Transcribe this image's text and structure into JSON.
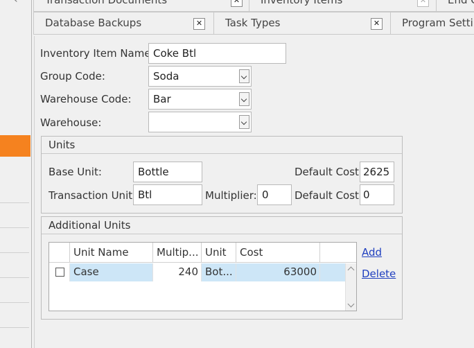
{
  "tabs_top": [
    {
      "label": "Transaction Documents"
    },
    {
      "label": "Inventory Items"
    },
    {
      "label": "End O"
    }
  ],
  "tabs": [
    {
      "label": "Database Backups"
    },
    {
      "label": "Task Types"
    },
    {
      "label": "Program Settin"
    }
  ],
  "form": {
    "item_name_label": "Inventory Item Name:",
    "item_name_value": "Coke Btl",
    "group_code_label": "Group Code:",
    "group_code_value": "Soda",
    "warehouse_code_label": "Warehouse Code:",
    "warehouse_code_value": "Bar",
    "warehouse_label": "Warehouse:",
    "warehouse_value": ""
  },
  "units": {
    "title": "Units",
    "base_unit_label": "Base Unit:",
    "base_unit_value": "Bottle",
    "default_cost_label": "Default Cost:",
    "default_cost_value": "2625",
    "transaction_unit_label": "Transaction Unit:",
    "transaction_unit_value": "Btl",
    "multiplier_label": "Multiplier:",
    "multiplier_value": "0",
    "default_cost2_label": "Default Cost:",
    "default_cost2_value": "0"
  },
  "additional_units": {
    "title": "Additional Units",
    "columns": [
      "Unit Name",
      "Multip...",
      "Unit",
      "Cost"
    ],
    "rows": [
      {
        "unit_name": "Case",
        "multiplier": "240",
        "unit": "Bot...",
        "cost": "63000"
      }
    ],
    "add_label": "Add",
    "delete_label": "Delete"
  }
}
